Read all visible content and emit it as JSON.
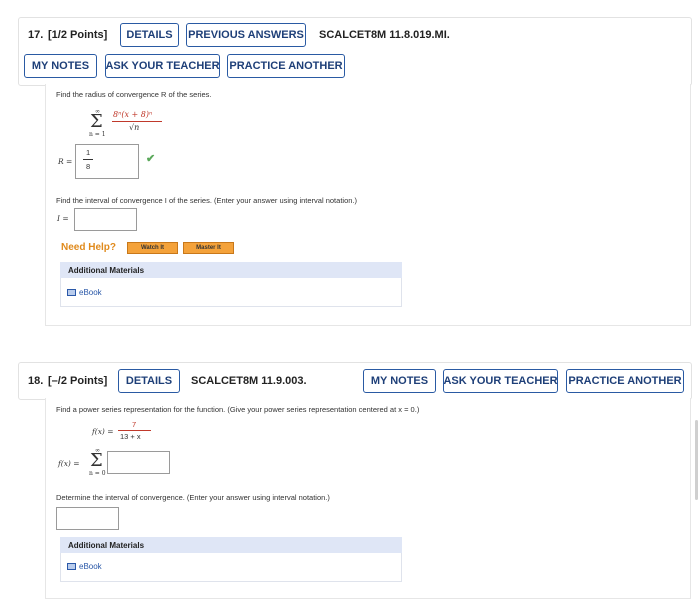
{
  "q17": {
    "number": "17.",
    "points": "[1/2 Points]",
    "details_btn": "DETAILS",
    "prev_answers_btn": "PREVIOUS ANSWERS",
    "code": "SCALCET8M 11.8.019.MI.",
    "my_notes_btn": "MY NOTES",
    "ask_teacher_btn": "ASK YOUR TEACHER",
    "practice_btn": "PRACTICE ANOTHER",
    "prompt_radius": "Find the radius of convergence R of the series.",
    "sum_upper": "∞",
    "sum_lower": "n = 1",
    "sum_numerator": "8ⁿ(x + 8)ⁿ",
    "sum_denominator": "√n",
    "r_label": "R =",
    "r_answer_num": "1",
    "r_answer_den": "8",
    "r_status": "correct",
    "prompt_interval": "Find the interval of convergence I of the series. (Enter your answer using interval notation.)",
    "i_label": "I =",
    "i_value": "",
    "need_help": "Need Help?",
    "watch_btn": "Watch It",
    "master_btn": "Master It",
    "additional_materials": "Additional Materials",
    "ebook": "eBook"
  },
  "q18": {
    "number": "18.",
    "points": "[–/2 Points]",
    "details_btn": "DETAILS",
    "code": "SCALCET8M 11.9.003.",
    "my_notes_btn": "MY NOTES",
    "ask_teacher_btn": "ASK YOUR TEACHER",
    "practice_btn": "PRACTICE ANOTHER",
    "prompt_series": "Find a power series representation for the function. (Give your power series representation centered at x = 0.)",
    "fx_label": "f(x) =",
    "fx_numerator": "7",
    "fx_denominator": "13 + x",
    "fx_label2": "f(x) =",
    "sum_upper": "∞",
    "sum_lower": "n = 0",
    "series_value": "",
    "prompt_interval": "Determine the interval of convergence. (Enter your answer using interval notation.)",
    "interval_value": "",
    "additional_materials": "Additional Materials",
    "ebook": "eBook"
  },
  "colors": {
    "button_border": "#2a5aa3",
    "need_help": "#e08a1c",
    "correct_check": "#5aa85a",
    "fraction_red": "#c0392b",
    "materials_bar": "#dfe6f6"
  }
}
